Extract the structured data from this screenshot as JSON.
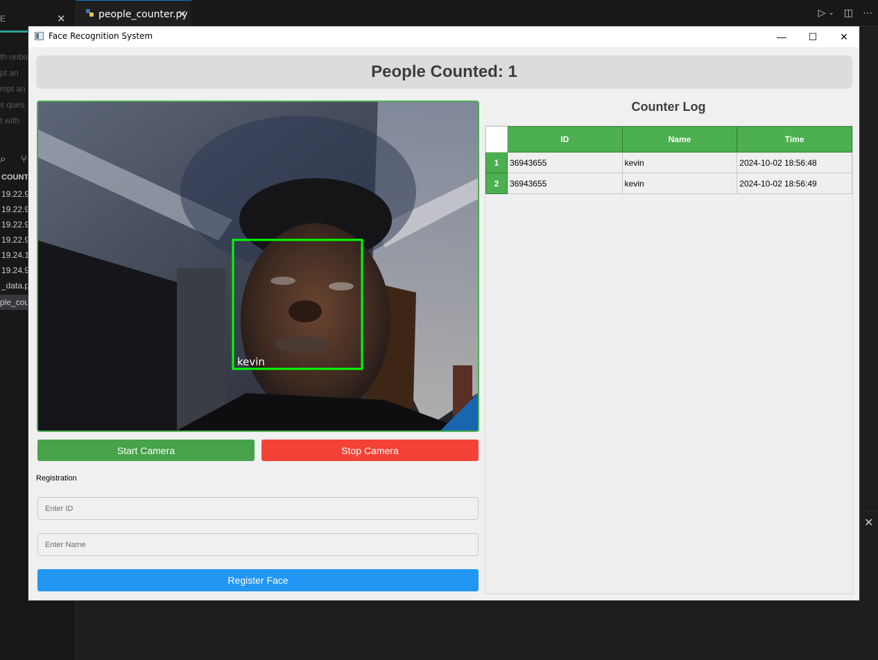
{
  "editor": {
    "active_tab": "people_counter.py",
    "left_tab_fragment": "E",
    "ghost_lines": [
      "th onbo",
      "pt an",
      "mpt an",
      "s ques",
      "t with"
    ],
    "explorer_heading": "COUNT",
    "explorer_items": [
      "19.22.9",
      "19.22.9",
      "19.22.9",
      "19.22.9",
      "19.24.1",
      "19.24.9",
      "_data.p",
      "ple_cou"
    ]
  },
  "window": {
    "title": "Face Recognition System",
    "minimize": "—",
    "maximize": "☐",
    "close": "✕"
  },
  "header": {
    "counter_text": "People Counted: 1"
  },
  "video": {
    "face_label": "kevin",
    "box_color": "#00ff00"
  },
  "controls": {
    "start_camera": "Start Camera",
    "stop_camera": "Stop Camera",
    "registration_label": "Registration",
    "id_placeholder": "Enter ID",
    "name_placeholder": "Enter Name",
    "register_button": "Register Face"
  },
  "log": {
    "title": "Counter Log",
    "columns": [
      "ID",
      "Name",
      "Time"
    ],
    "rows": [
      {
        "num": "1",
        "id": "36943655",
        "name": "kevin",
        "time": "2024-10-02 18:56:48"
      },
      {
        "num": "2",
        "id": "36943655",
        "name": "kevin",
        "time": "2024-10-02 18:56:49"
      }
    ]
  },
  "colors": {
    "green": "#4caf50",
    "red": "#f44336",
    "blue": "#2196f3"
  }
}
